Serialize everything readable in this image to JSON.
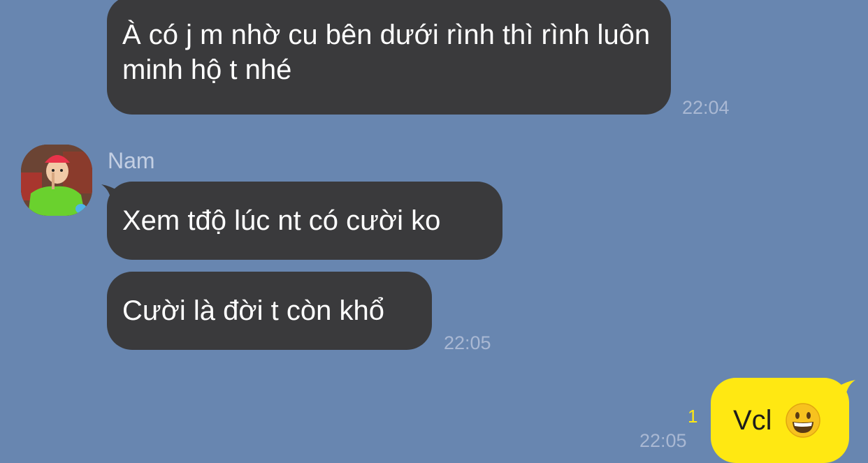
{
  "messages": [
    {
      "id": "m1",
      "text": "À có j m nhờ cu bên dưới rình thì rình luôn minh hộ t nhé",
      "time": "22:04"
    },
    {
      "id": "m2",
      "sender": "Nam",
      "text": "Xem tđộ lúc nt có cười ko"
    },
    {
      "id": "m3",
      "text": "Cười là đời t còn khổ",
      "time": "22:05"
    },
    {
      "id": "m4",
      "text": "Vcl",
      "emoji": "grinning-face-emoji",
      "time": "22:05",
      "unread_count": "1"
    }
  ],
  "colors": {
    "background": "#6886b0",
    "incoming_bubble": "#3a3a3c",
    "outgoing_bubble": "#ffe812",
    "time_text": "#a9b8d3",
    "unread_text": "#ffe812"
  },
  "icons": {
    "avatar": "avatar-photo"
  }
}
